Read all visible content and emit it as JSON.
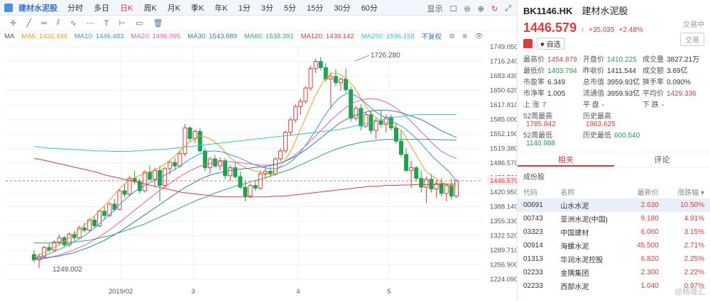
{
  "topbar": {
    "title": "建材水泥股",
    "periods": [
      "分时",
      "多日",
      "日K",
      "周K",
      "月K",
      "季K",
      "年K",
      "1分",
      "3分",
      "5分",
      "15分",
      "30分",
      "60分"
    ],
    "active_period": "日K",
    "display_label": "显示"
  },
  "ma_line": {
    "label": "MA",
    "ma5": "MA5: 1432.494",
    "ma10": "MA10: 1446.483",
    "ma20": "MA20: 1496.995",
    "ma30": "MA30: 1543.889",
    "ma60": "MA60: 1538.391",
    "ma120": "MA120: 1439.142",
    "ma250": "MA250: 1596.158",
    "adjust": "不复权"
  },
  "colors": {
    "up": "#e03a3a",
    "down": "#18a54d",
    "ma5": "#f39c12",
    "ma10": "#3498db",
    "ma20": "#e85db8",
    "ma30": "#2c7fb8",
    "ma60": "#27ae60",
    "ma120": "#e03a3a",
    "ma250": "#2ec4d6"
  },
  "chart_data": {
    "type": "candlestick",
    "y_ticks": [
      "1749.050",
      "1716.240",
      "1683.430",
      "1650.620",
      "1617.810",
      "1585.000",
      "1552.190",
      "1519.380",
      "1486.570",
      "1453.760",
      "1420.950",
      "1388.140",
      "1355.330",
      "1322.520",
      "1289.710",
      "1256.900",
      "1224.090"
    ],
    "ylim": [
      1224.09,
      1749.05
    ],
    "x_labels": [
      "2019/02",
      "3",
      "4",
      "5"
    ],
    "current_price_label": "1446.579",
    "high_annotation": "1726.280",
    "low_annotation": "1249.002",
    "candles_ohlc": [
      [
        1280,
        1290,
        1262,
        1268
      ],
      [
        1268,
        1282,
        1249,
        1275
      ],
      [
        1275,
        1300,
        1272,
        1296
      ],
      [
        1296,
        1305,
        1285,
        1290
      ],
      [
        1290,
        1312,
        1286,
        1308
      ],
      [
        1308,
        1325,
        1300,
        1318
      ],
      [
        1318,
        1322,
        1298,
        1302
      ],
      [
        1302,
        1330,
        1298,
        1326
      ],
      [
        1326,
        1334,
        1312,
        1318
      ],
      [
        1318,
        1346,
        1315,
        1340
      ],
      [
        1340,
        1352,
        1330,
        1335
      ],
      [
        1335,
        1362,
        1330,
        1358
      ],
      [
        1358,
        1366,
        1340,
        1345
      ],
      [
        1345,
        1382,
        1342,
        1378
      ],
      [
        1378,
        1388,
        1360,
        1368
      ],
      [
        1368,
        1398,
        1365,
        1394
      ],
      [
        1394,
        1405,
        1378,
        1382
      ],
      [
        1382,
        1428,
        1380,
        1424
      ],
      [
        1424,
        1440,
        1410,
        1416
      ],
      [
        1416,
        1458,
        1412,
        1452
      ],
      [
        1452,
        1470,
        1438,
        1445
      ],
      [
        1445,
        1452,
        1418,
        1424
      ],
      [
        1424,
        1470,
        1420,
        1466
      ],
      [
        1466,
        1482,
        1446,
        1450
      ],
      [
        1450,
        1476,
        1432,
        1470
      ],
      [
        1470,
        1480,
        1400,
        1436
      ],
      [
        1436,
        1478,
        1430,
        1474
      ],
      [
        1474,
        1492,
        1460,
        1488
      ],
      [
        1488,
        1498,
        1470,
        1480
      ],
      [
        1480,
        1515,
        1476,
        1508
      ],
      [
        1508,
        1575,
        1502,
        1566
      ],
      [
        1566,
        1570,
        1535,
        1542
      ],
      [
        1542,
        1562,
        1532,
        1558
      ],
      [
        1558,
        1565,
        1510,
        1514
      ],
      [
        1514,
        1520,
        1468,
        1476
      ],
      [
        1476,
        1500,
        1462,
        1496
      ],
      [
        1496,
        1505,
        1476,
        1480
      ],
      [
        1480,
        1500,
        1470,
        1492
      ],
      [
        1492,
        1498,
        1450,
        1458
      ],
      [
        1458,
        1482,
        1446,
        1476
      ],
      [
        1476,
        1488,
        1450,
        1456
      ],
      [
        1456,
        1468,
        1428,
        1432
      ],
      [
        1432,
        1446,
        1400,
        1412
      ],
      [
        1412,
        1440,
        1408,
        1436
      ],
      [
        1436,
        1448,
        1424,
        1430
      ],
      [
        1430,
        1470,
        1426,
        1462
      ],
      [
        1462,
        1480,
        1450,
        1468
      ],
      [
        1468,
        1478,
        1455,
        1462
      ],
      [
        1462,
        1500,
        1458,
        1496
      ],
      [
        1496,
        1520,
        1490,
        1514
      ],
      [
        1514,
        1560,
        1508,
        1556
      ],
      [
        1556,
        1590,
        1548,
        1584
      ],
      [
        1584,
        1620,
        1578,
        1614
      ],
      [
        1614,
        1632,
        1596,
        1626
      ],
      [
        1626,
        1660,
        1620,
        1656
      ],
      [
        1656,
        1706,
        1650,
        1700
      ],
      [
        1700,
        1722,
        1690,
        1716
      ],
      [
        1716,
        1726,
        1696,
        1702
      ],
      [
        1702,
        1712,
        1670,
        1676
      ],
      [
        1676,
        1690,
        1610,
        1682
      ],
      [
        1682,
        1698,
        1660,
        1668
      ],
      [
        1668,
        1680,
        1650,
        1676
      ],
      [
        1676,
        1700,
        1646,
        1652
      ],
      [
        1652,
        1660,
        1580,
        1588
      ],
      [
        1588,
        1616,
        1582,
        1610
      ],
      [
        1610,
        1620,
        1560,
        1570
      ],
      [
        1570,
        1602,
        1566,
        1596
      ],
      [
        1596,
        1604,
        1552,
        1560
      ],
      [
        1560,
        1588,
        1540,
        1582
      ],
      [
        1582,
        1606,
        1566,
        1574
      ],
      [
        1574,
        1596,
        1556,
        1590
      ],
      [
        1590,
        1596,
        1560,
        1566
      ],
      [
        1566,
        1578,
        1530,
        1536
      ],
      [
        1536,
        1560,
        1500,
        1506
      ],
      [
        1506,
        1520,
        1466,
        1470
      ],
      [
        1470,
        1492,
        1430,
        1476
      ],
      [
        1476,
        1480,
        1446,
        1452
      ],
      [
        1452,
        1470,
        1420,
        1432
      ],
      [
        1432,
        1456,
        1396,
        1450
      ],
      [
        1450,
        1462,
        1420,
        1428
      ],
      [
        1428,
        1448,
        1408,
        1440
      ],
      [
        1440,
        1452,
        1412,
        1418
      ],
      [
        1418,
        1440,
        1400,
        1436
      ],
      [
        1436,
        1452,
        1404,
        1412
      ],
      [
        1412,
        1450,
        1408,
        1446
      ]
    ],
    "ma_series": [
      {
        "name": "MA5",
        "color": "#f39c12",
        "values": [
          1275,
          1282,
          1290,
          1300,
          1312,
          1325,
          1340,
          1355,
          1372,
          1390,
          1410,
          1430,
          1445,
          1455,
          1462,
          1468,
          1476,
          1488,
          1502,
          1520,
          1535,
          1548,
          1545,
          1536,
          1520,
          1500,
          1486,
          1476,
          1470,
          1466,
          1462,
          1470,
          1490,
          1520,
          1560,
          1600,
          1640,
          1672,
          1690,
          1688,
          1676,
          1656,
          1626,
          1600,
          1586,
          1578,
          1570,
          1560,
          1530,
          1500,
          1470,
          1456,
          1444,
          1436,
          1432
        ]
      },
      {
        "name": "MA10",
        "color": "#3498db",
        "values": [
          1272,
          1276,
          1282,
          1290,
          1298,
          1308,
          1318,
          1330,
          1344,
          1360,
          1376,
          1394,
          1410,
          1424,
          1434,
          1444,
          1452,
          1462,
          1472,
          1484,
          1496,
          1506,
          1512,
          1514,
          1512,
          1506,
          1500,
          1492,
          1484,
          1478,
          1474,
          1474,
          1480,
          1492,
          1510,
          1534,
          1560,
          1590,
          1614,
          1634,
          1644,
          1640,
          1628,
          1612,
          1598,
          1588,
          1578,
          1570,
          1556,
          1540,
          1520,
          1500,
          1484,
          1468,
          1446
        ]
      },
      {
        "name": "MA20",
        "color": "#e85db8",
        "values": [
          1268,
          1270,
          1273,
          1278,
          1284,
          1290,
          1298,
          1306,
          1316,
          1328,
          1340,
          1354,
          1368,
          1382,
          1396,
          1410,
          1424,
          1436,
          1448,
          1460,
          1470,
          1478,
          1484,
          1488,
          1490,
          1490,
          1488,
          1486,
          1484,
          1482,
          1482,
          1484,
          1490,
          1500,
          1514,
          1530,
          1548,
          1566,
          1584,
          1600,
          1614,
          1624,
          1630,
          1632,
          1630,
          1624,
          1614,
          1600,
          1584,
          1566,
          1548,
          1530,
          1514,
          1504,
          1497
        ]
      },
      {
        "name": "MA30",
        "color": "#2c7fb8",
        "values": [
          1272,
          1272,
          1274,
          1276,
          1280,
          1284,
          1290,
          1296,
          1304,
          1312,
          1322,
          1332,
          1344,
          1356,
          1368,
          1380,
          1392,
          1404,
          1416,
          1428,
          1438,
          1448,
          1456,
          1462,
          1466,
          1470,
          1472,
          1474,
          1476,
          1478,
          1480,
          1484,
          1490,
          1498,
          1508,
          1520,
          1534,
          1548,
          1562,
          1576,
          1586,
          1594,
          1600,
          1604,
          1606,
          1606,
          1604,
          1600,
          1594,
          1588,
          1580,
          1570,
          1560,
          1552,
          1544
        ]
      },
      {
        "name": "MA60",
        "color": "#27ae60",
        "values": [
          1306,
          1306,
          1306,
          1306,
          1306,
          1308,
          1310,
          1312,
          1316,
          1320,
          1324,
          1330,
          1336,
          1342,
          1348,
          1356,
          1364,
          1372,
          1380,
          1388,
          1396,
          1404,
          1410,
          1418,
          1424,
          1430,
          1436,
          1440,
          1446,
          1450,
          1456,
          1462,
          1468,
          1474,
          1482,
          1490,
          1498,
          1506,
          1514,
          1520,
          1526,
          1530,
          1534,
          1536,
          1538,
          1540,
          1540,
          1540,
          1540,
          1540,
          1540,
          1540,
          1539,
          1539,
          1538
        ]
      },
      {
        "name": "MA120",
        "color": "#e03a3a",
        "values": [
          1497,
          1494,
          1490,
          1486,
          1482,
          1478,
          1474,
          1470,
          1466,
          1460,
          1456,
          1452,
          1448,
          1444,
          1440,
          1436,
          1432,
          1428,
          1424,
          1420,
          1418,
          1416,
          1414,
          1412,
          1410,
          1410,
          1410,
          1410,
          1410,
          1410,
          1410,
          1412,
          1412,
          1414,
          1416,
          1418,
          1420,
          1422,
          1424,
          1426,
          1428,
          1430,
          1432,
          1434,
          1434,
          1436,
          1436,
          1437,
          1437,
          1438,
          1438,
          1438,
          1439,
          1439,
          1439
        ]
      },
      {
        "name": "MA250",
        "color": "#2ec4d6",
        "values": [
          1524,
          1522,
          1520,
          1519,
          1518,
          1517,
          1516,
          1515,
          1514,
          1514,
          1513,
          1513,
          1513,
          1514,
          1515,
          1516,
          1517,
          1518,
          1520,
          1522,
          1524,
          1526,
          1528,
          1530,
          1532,
          1534,
          1536,
          1538,
          1540,
          1542,
          1544,
          1546,
          1548,
          1550,
          1552,
          1554,
          1556,
          1558,
          1560,
          1562,
          1566,
          1570,
          1574,
          1578,
          1582,
          1586,
          1590,
          1592,
          1594,
          1596,
          1596,
          1596,
          1596,
          1596,
          1596
        ]
      }
    ]
  },
  "side": {
    "code": "BK1146.HK",
    "name": "建材水泥股",
    "trade_status": "交易中",
    "price": "1446.579",
    "arrow": "↑",
    "change": "+35.035",
    "change_pct": "+2.48%",
    "watch_label": "自选",
    "trade_label": "交易",
    "stats": [
      {
        "k": "最高价",
        "v": "1454.879",
        "c": "red"
      },
      {
        "k": "开盘价",
        "v": "1410.225",
        "c": "green"
      },
      {
        "k": "成交量",
        "v": "3827.21万",
        "c": ""
      },
      {
        "k": "最低价",
        "v": "1403.794",
        "c": "green"
      },
      {
        "k": "昨收价",
        "v": "1411.544",
        "c": ""
      },
      {
        "k": "成交额",
        "v": "3.69亿",
        "c": ""
      },
      {
        "k": "市盈率",
        "v": "6.349",
        "c": ""
      },
      {
        "k": "总市值",
        "v": "3959.93亿",
        "c": ""
      },
      {
        "k": "换手率",
        "v": "0.090%",
        "c": ""
      },
      {
        "k": "市净率",
        "v": "1.005",
        "c": ""
      },
      {
        "k": "流通值",
        "v": "3959.93亿",
        "c": ""
      },
      {
        "k": "平均价",
        "v": "1429.336",
        "c": "red"
      },
      {
        "k": "上 涨",
        "v": "7",
        "c": "red"
      },
      {
        "k": "平 盘",
        "v": "-",
        "c": ""
      },
      {
        "k": "下 跌",
        "v": "-",
        "c": ""
      },
      {
        "k": "52周最高",
        "v": "1785.842",
        "c": "red"
      },
      {
        "k": "历史最高",
        "v": "1963.625",
        "c": "red"
      },
      {
        "k": "",
        "v": "",
        "c": ""
      },
      {
        "k": "52周最低",
        "v": "1140.988",
        "c": "green"
      },
      {
        "k": "历史最低",
        "v": "600.540",
        "c": "green"
      },
      {
        "k": "",
        "v": "",
        "c": ""
      }
    ],
    "tabs": [
      "相关",
      "评论"
    ],
    "section": "成份股",
    "table_headers": [
      "代码",
      "名称",
      "最新价",
      "涨跌幅"
    ],
    "rows": [
      [
        "00691",
        "山水水泥",
        "2.630",
        "10.50%"
      ],
      [
        "00743",
        "亚洲水泥(中国)",
        "9.180",
        "4.91%"
      ],
      [
        "03323",
        "中国建材",
        "6.060",
        "3.15%"
      ],
      [
        "00914",
        "海螺水泥",
        "45.500",
        "2.71%"
      ],
      [
        "01313",
        "华润水泥控股",
        "6.820",
        "2.25%"
      ],
      [
        "02233",
        "金隅集团",
        "2.300",
        "2.22%"
      ],
      [
        "02233",
        "西部水泥",
        "1.040",
        "0.97%"
      ]
    ],
    "watermark": "@格隆汇"
  }
}
